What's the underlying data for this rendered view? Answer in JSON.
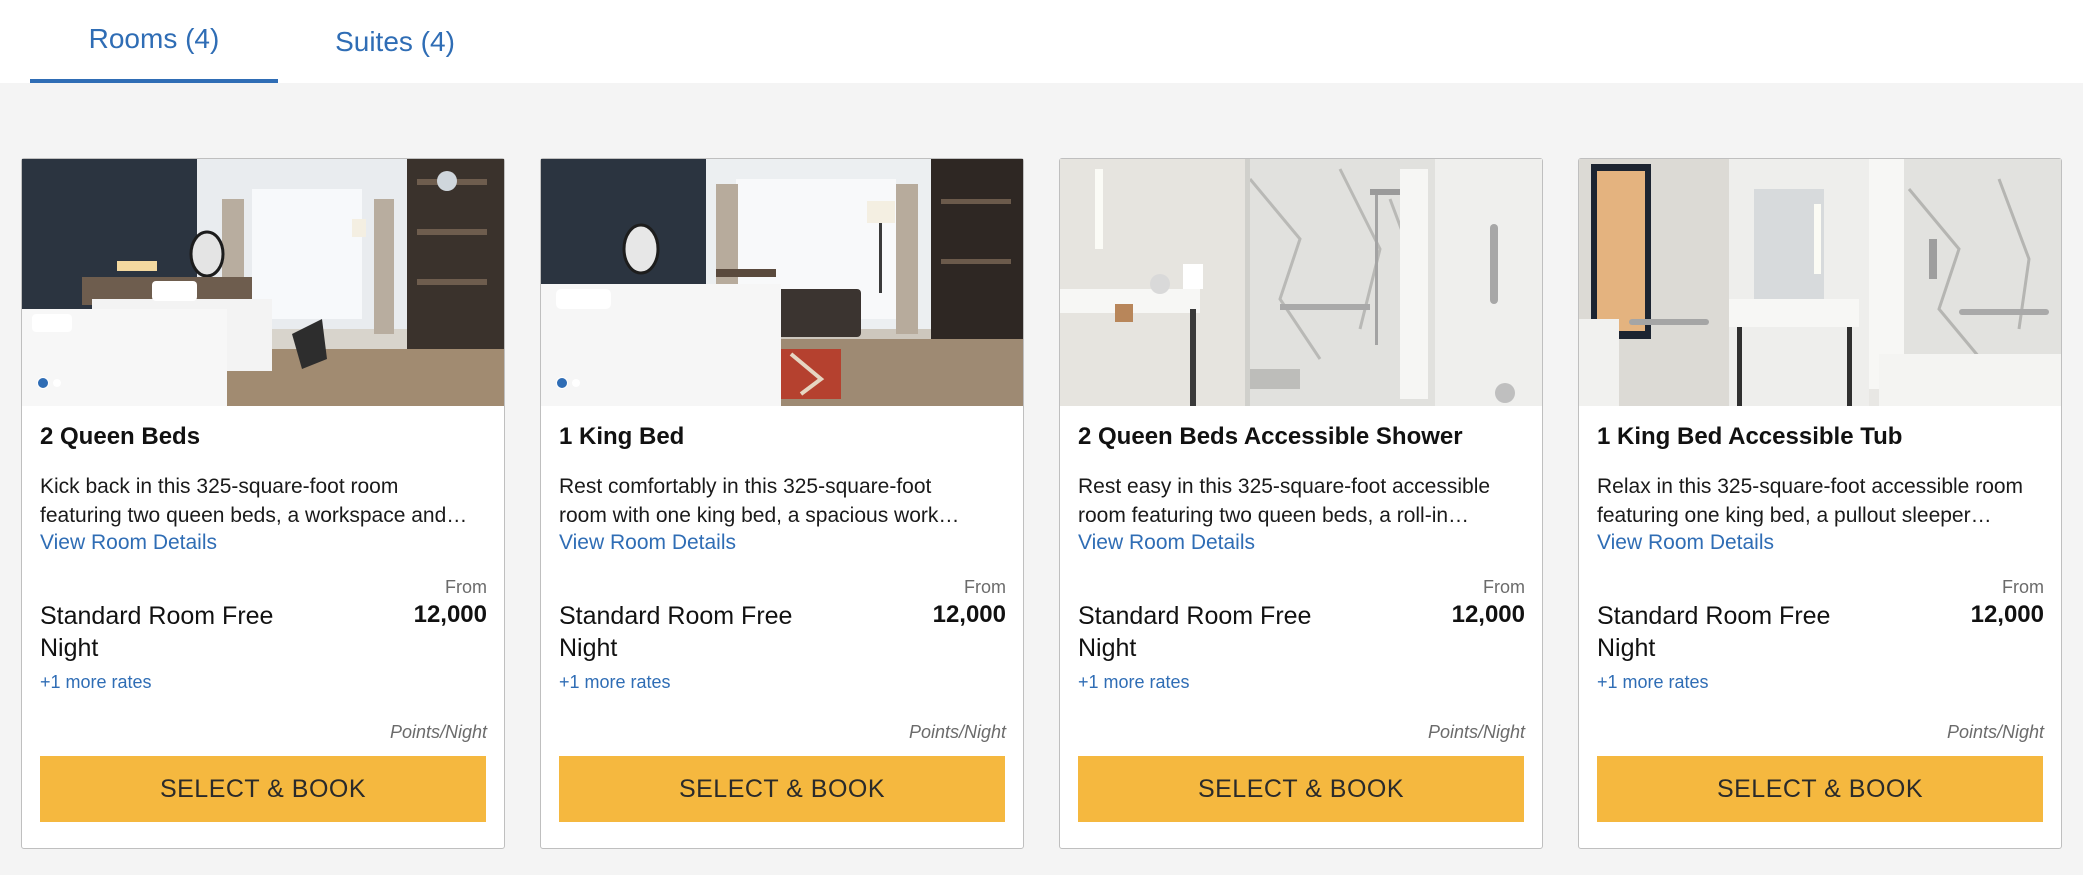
{
  "tabs": [
    {
      "label": "Rooms (4)",
      "active": true
    },
    {
      "label": "Suites (4)",
      "active": false
    }
  ],
  "colors": {
    "accent": "#2f6db5",
    "button": "#f5b83f",
    "background": "#f4f4f4"
  },
  "rooms": [
    {
      "title": "2 Queen Beds",
      "desc_line1": "Kick back in this 325-square-foot room",
      "desc_line2": "featuring two queen beds, a workspace and…",
      "details_link": "View Room Details",
      "from_label": "From",
      "rate_name": "Standard Room Free Night",
      "points": "12,000",
      "more_rates": "+1 more rates",
      "unit": "Points/Night",
      "button": "SELECT & BOOK",
      "has_carousel_dots": true,
      "image": "hotel-room-two-queen-beds"
    },
    {
      "title": "1 King Bed",
      "desc_line1": "Rest comfortably in this 325-square-foot",
      "desc_line2": "room with one king bed, a spacious work…",
      "details_link": "View Room Details",
      "from_label": "From",
      "rate_name": "Standard Room Free Night",
      "points": "12,000",
      "more_rates": "+1 more rates",
      "unit": "Points/Night",
      "button": "SELECT & BOOK",
      "has_carousel_dots": true,
      "image": "hotel-room-king-bed-sofa"
    },
    {
      "title": "2 Queen Beds Accessible Shower",
      "desc_line1": "Rest easy in this 325-square-foot accessible",
      "desc_line2": "room featuring two queen beds, a roll-in…",
      "details_link": "View Room Details",
      "from_label": "From",
      "rate_name": "Standard Room Free Night",
      "points": "12,000",
      "more_rates": "+1 more rates",
      "unit": "Points/Night",
      "button": "SELECT & BOOK",
      "has_carousel_dots": false,
      "image": "accessible-roll-in-shower-bathroom"
    },
    {
      "title": "1 King Bed Accessible Tub",
      "desc_line1": "Relax in this 325-square-foot accessible room",
      "desc_line2": "featuring one king bed, a pullout sleeper…",
      "details_link": "View Room Details",
      "from_label": "From",
      "rate_name": "Standard Room Free Night",
      "points": "12,000",
      "more_rates": "+1 more rates",
      "unit": "Points/Night",
      "button": "SELECT & BOOK",
      "has_carousel_dots": false,
      "image": "accessible-bathroom-with-tub"
    }
  ]
}
